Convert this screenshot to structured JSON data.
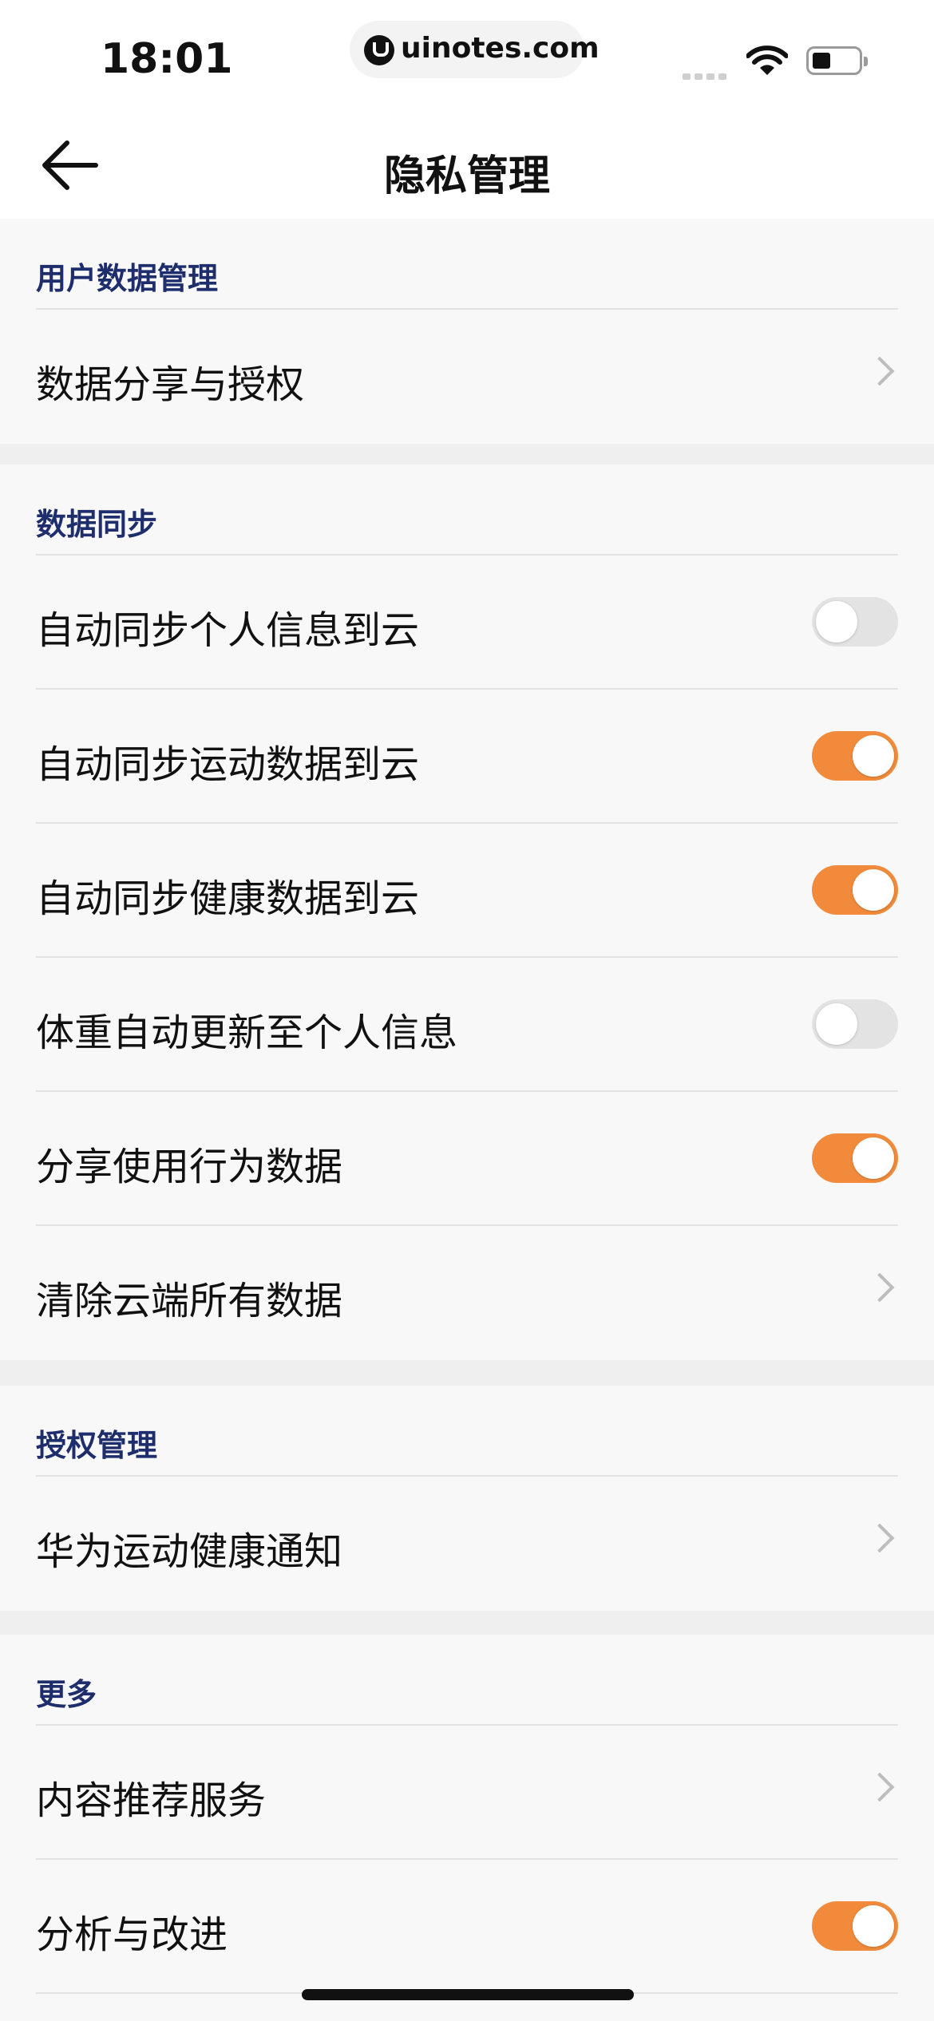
{
  "status_bar": {
    "time": "18:01",
    "url": "uinotes.com"
  },
  "nav": {
    "title": "隐私管理"
  },
  "accent_color": "#f18b3b",
  "header_color": "#1e2d6b",
  "sections": [
    {
      "header": "用户数据管理",
      "rows": [
        {
          "label": "数据分享与授权",
          "control": "chevron"
        }
      ]
    },
    {
      "header": "数据同步",
      "rows": [
        {
          "label": "自动同步个人信息到云",
          "control": "toggle",
          "on": false
        },
        {
          "label": "自动同步运动数据到云",
          "control": "toggle",
          "on": true
        },
        {
          "label": "自动同步健康数据到云",
          "control": "toggle",
          "on": true
        },
        {
          "label": "体重自动更新至个人信息",
          "control": "toggle",
          "on": false
        },
        {
          "label": "分享使用行为数据",
          "control": "toggle",
          "on": true
        },
        {
          "label": "清除云端所有数据",
          "control": "chevron"
        }
      ]
    },
    {
      "header": "授权管理",
      "rows": [
        {
          "label": "华为运动健康通知",
          "control": "chevron"
        }
      ]
    },
    {
      "header": "更多",
      "rows": [
        {
          "label": "内容推荐服务",
          "control": "chevron"
        },
        {
          "label": "分析与改进",
          "control": "toggle",
          "on": true
        }
      ]
    }
  ]
}
